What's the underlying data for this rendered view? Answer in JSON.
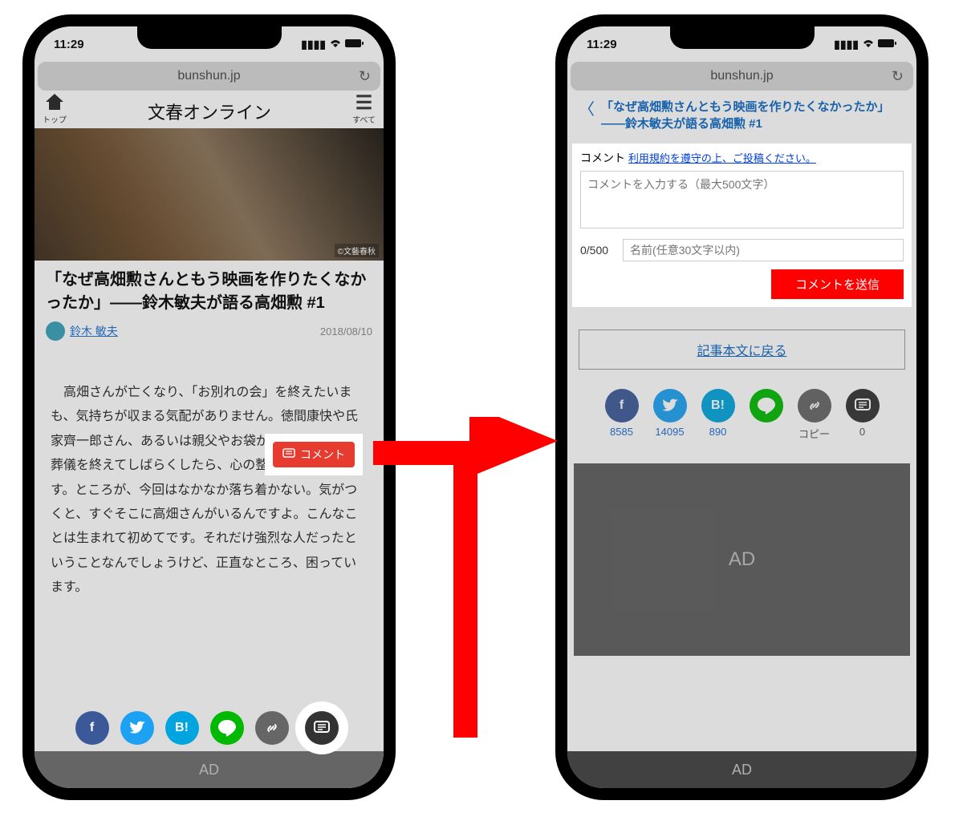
{
  "status": {
    "time": "11:29"
  },
  "browser": {
    "url": "bunshun.jp"
  },
  "left": {
    "header": {
      "homeLabel": "トップ",
      "brand": "文春オンライン",
      "menuLabel": "すべて"
    },
    "heroCaption": "©文藝春秋",
    "title": "「なぜ高畑勲さんともう映画を作りたくなかったか」――鈴木敏夫が語る高畑勲 #1",
    "author": "鈴木 敏夫",
    "date": "2018/08/10",
    "commentButton": "コメント",
    "body": "高畑さんが亡くなり、「お別れの会」を終えたいまも、気持ちが収まる気配がありません。徳間康快や氏家齊一郎さん、あるいは親父やお袋が死んだときも、葬儀を終えてしばらくしたら、心の整理はついたんです。ところが、今回はなかなか落ち着かない。気がつくと、すぐそこに高畑さんがいるんですよ。こんなことは生まれて初めてです。それだけ強烈な人だったということなんでしょうけど、正直なところ、困っています。",
    "ad": "AD"
  },
  "right": {
    "backTitle": "「なぜ高畑勲さんともう映画を作りたくなかったか」――鈴木敏夫が語る高畑勲 #1",
    "commentLabel": "コメント",
    "termsLink": "利用規約を遵守の上、ご投稿ください。",
    "textareaPlaceholder": "コメントを入力する（最大500文字）",
    "counter": "0/500",
    "namePlaceholder": "名前(任意30文字以内)",
    "sendLabel": "コメントを送信",
    "backArticle": "記事本文に戻る",
    "share": {
      "fb": "8585",
      "tw": "14095",
      "hb": "890",
      "copy": "コピー",
      "cm": "0"
    },
    "adBig": "AD",
    "adBar": "AD"
  }
}
